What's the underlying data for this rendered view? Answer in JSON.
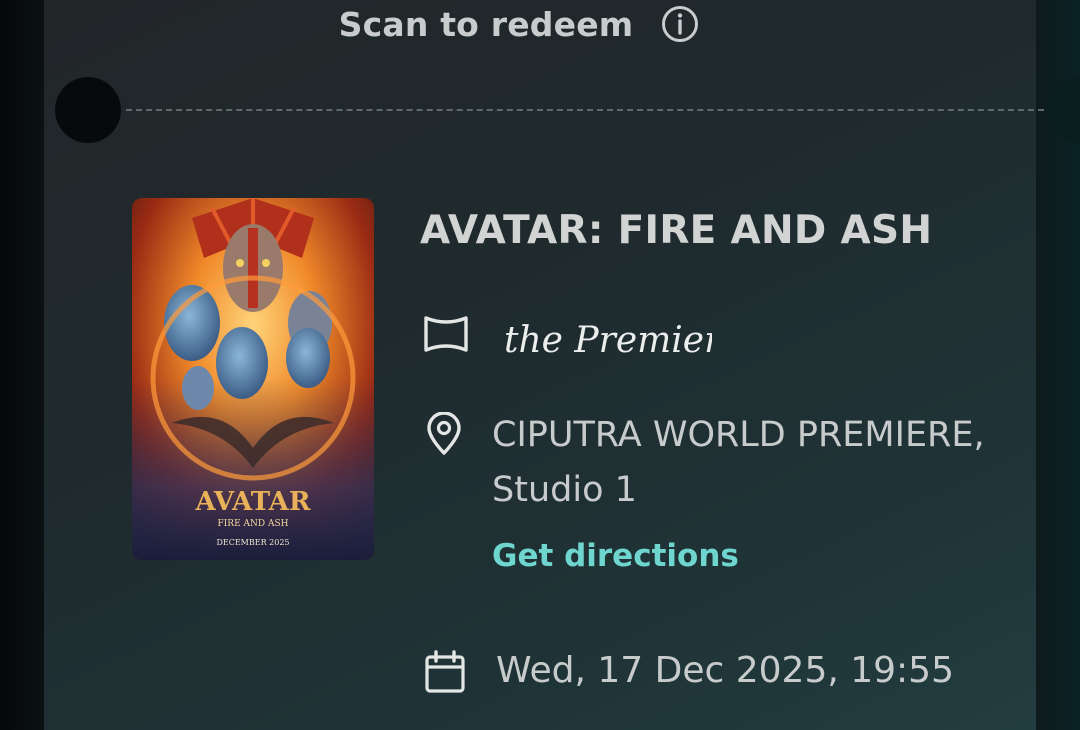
{
  "ticket": {
    "scan_label": "Scan to redeem",
    "info_icon": "info-icon",
    "movie_title": "AVATAR: FIRE AND ASH",
    "format_icon": "screen-icon",
    "format_logo_text": "the Premiere",
    "location_icon": "location-pin-icon",
    "venue_line1": "CIPUTRA WORLD PREMIERE,",
    "venue_line2": "Studio 1",
    "directions_label": "Get directions",
    "calendar_icon": "calendar-icon",
    "showtime": "Wed, 17 Dec 2025, 19:55",
    "poster": {
      "title_text": "AVATAR",
      "subtitle_text": "FIRE AND ASH",
      "release_text": "DECEMBER 2025"
    }
  },
  "colors": {
    "accent": "#6fd6cf",
    "text_primary": "#d2d4d4",
    "ticket_bg": "#222a2d"
  }
}
